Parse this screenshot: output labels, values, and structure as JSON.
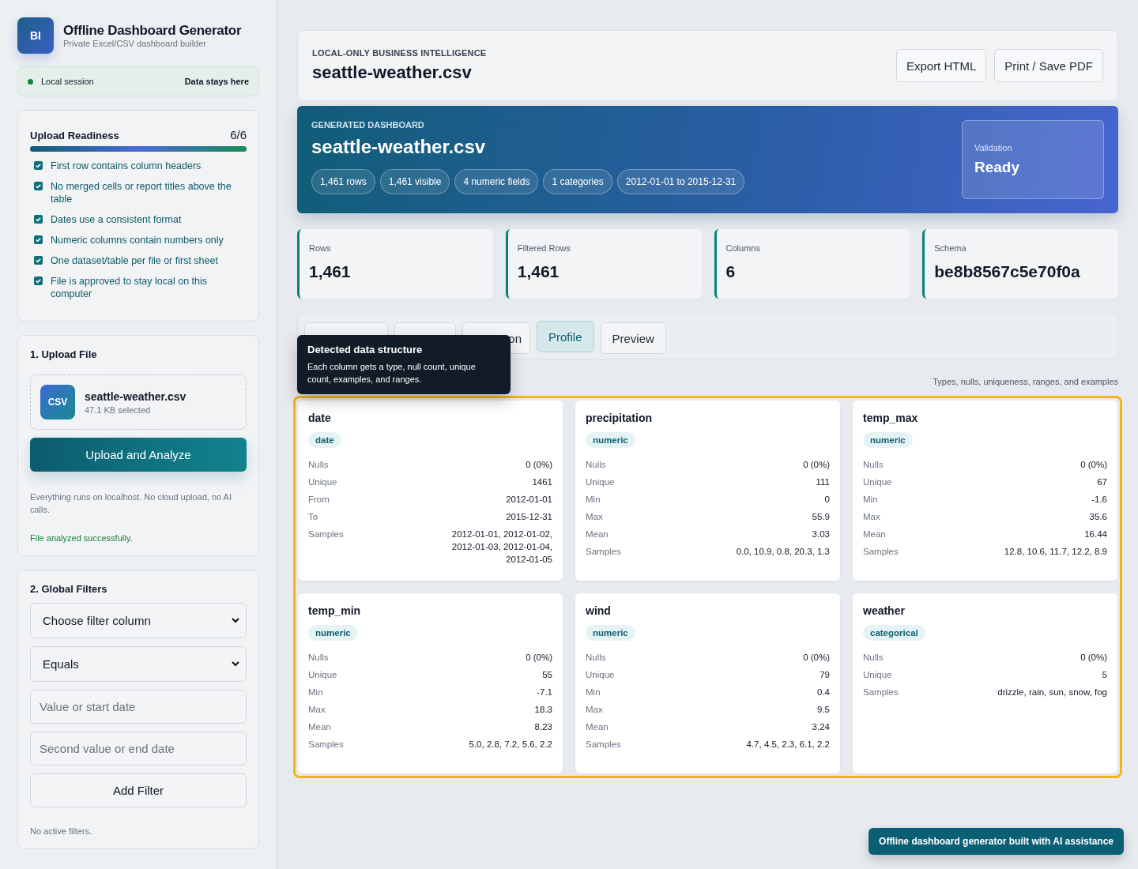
{
  "brand": {
    "logo": "BI",
    "title": "Offline Dashboard Generator",
    "subtitle": "Private Excel/CSV dashboard builder"
  },
  "session": {
    "label": "Local session",
    "note": "Data stays here"
  },
  "readiness": {
    "title": "Upload Readiness",
    "count": "6/6",
    "level": 1,
    "items": [
      {
        "label": "First row contains column headers",
        "checked": true
      },
      {
        "label": "No merged cells or report titles above the table",
        "checked": true
      },
      {
        "label": "Dates use a consistent format",
        "checked": true
      },
      {
        "label": "Numeric columns contain numbers only",
        "checked": true
      },
      {
        "label": "One dataset/table per file or first sheet",
        "checked": true
      },
      {
        "label": "File is approved to stay local on this computer",
        "checked": true
      }
    ]
  },
  "upload": {
    "title": "1. Upload File",
    "file_badge": "CSV",
    "file_name": "seattle-weather.csv",
    "file_size": "47.1 KB selected",
    "button": "Upload and Analyze",
    "note": "Everything runs on localhost. No cloud upload, no AI calls.",
    "status": "File analyzed successfully."
  },
  "filters": {
    "title": "2. Global Filters",
    "column_select": "Choose filter column",
    "operator_select": "Equals",
    "value_placeholder": "Value or start date",
    "value2_placeholder": "Second value or end date",
    "button": "Add Filter",
    "empty": "No active filters."
  },
  "header": {
    "eyebrow": "LOCAL-ONLY BUSINESS INTELLIGENCE",
    "title": "seattle-weather.csv",
    "buttons": [
      "Export HTML",
      "Print / Save PDF"
    ]
  },
  "hero": {
    "eyebrow": "GENERATED DASHBOARD",
    "title": "seattle-weather.csv",
    "chips": [
      "1,461 rows",
      "1,461 visible",
      "4 numeric fields",
      "1 categories",
      "2012-01-01 to 2015-12-31"
    ],
    "status_label": "Validation",
    "status": "Ready"
  },
  "stats": [
    {
      "label": "Rows",
      "value": "1,461"
    },
    {
      "label": "Filtered Rows",
      "value": "1,461"
    },
    {
      "label": "Columns",
      "value": "6"
    },
    {
      "label": "Schema",
      "value": "be8b8567c5e70f0a"
    }
  ],
  "tabs": [
    {
      "selected": false
    },
    {
      "selected": false
    },
    {
      "label": "on",
      "selected": false
    },
    {
      "label": "Profile",
      "selected": true
    },
    {
      "label": "Preview",
      "selected": false
    }
  ],
  "tooltip": {
    "title": "Detected data structure",
    "text": "Each column gets a type, null count, unique count, examples, and ranges."
  },
  "profile_caption": "Types, nulls, uniqueness, ranges, and examples",
  "columns": [
    {
      "name": "date",
      "type": "date",
      "stats": [
        [
          "Nulls",
          "0 (0%)"
        ],
        [
          "Unique",
          "1461"
        ],
        [
          "From",
          "2012-01-01"
        ],
        [
          "To",
          "2015-12-31"
        ],
        [
          "Samples",
          "2012-01-01, 2012-01-02, 2012-01-03, 2012-01-04, 2012-01-05"
        ]
      ]
    },
    {
      "name": "precipitation",
      "type": "numeric",
      "stats": [
        [
          "Nulls",
          "0 (0%)"
        ],
        [
          "Unique",
          "111"
        ],
        [
          "Min",
          "0"
        ],
        [
          "Max",
          "55.9"
        ],
        [
          "Mean",
          "3.03"
        ],
        [
          "Samples",
          "0.0, 10.9, 0.8, 20.3, 1.3"
        ]
      ]
    },
    {
      "name": "temp_max",
      "type": "numeric",
      "stats": [
        [
          "Nulls",
          "0 (0%)"
        ],
        [
          "Unique",
          "67"
        ],
        [
          "Min",
          "-1.6"
        ],
        [
          "Max",
          "35.6"
        ],
        [
          "Mean",
          "16.44"
        ],
        [
          "Samples",
          "12.8, 10.6, 11.7, 12.2, 8.9"
        ]
      ]
    },
    {
      "name": "temp_min",
      "type": "numeric",
      "stats": [
        [
          "Nulls",
          "0 (0%)"
        ],
        [
          "Unique",
          "55"
        ],
        [
          "Min",
          "-7.1"
        ],
        [
          "Max",
          "18.3"
        ],
        [
          "Mean",
          "8.23"
        ],
        [
          "Samples",
          "5.0, 2.8, 7.2, 5.6, 2.2"
        ]
      ]
    },
    {
      "name": "wind",
      "type": "numeric",
      "stats": [
        [
          "Nulls",
          "0 (0%)"
        ],
        [
          "Unique",
          "79"
        ],
        [
          "Min",
          "0.4"
        ],
        [
          "Max",
          "9.5"
        ],
        [
          "Mean",
          "3.24"
        ],
        [
          "Samples",
          "4.7, 4.5, 2.3, 6.1, 2.2"
        ]
      ]
    },
    {
      "name": "weather",
      "type": "categorical",
      "stats": [
        [
          "Nulls",
          "0 (0%)"
        ],
        [
          "Unique",
          "5"
        ],
        [
          "Samples",
          "drizzle, rain, sun, snow, fog"
        ]
      ]
    }
  ],
  "footer_badge": "Offline dashboard generator built with AI assistance"
}
